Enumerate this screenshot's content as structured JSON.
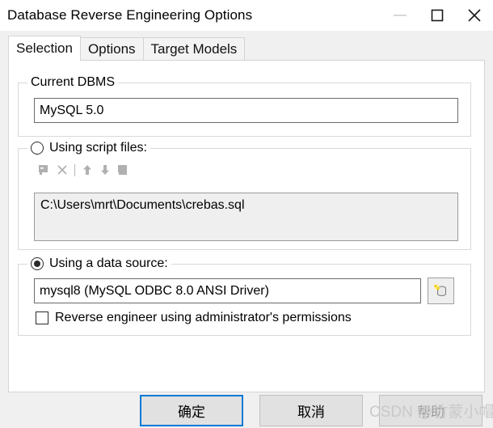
{
  "window": {
    "title": "Database Reverse Engineering Options",
    "controls": {
      "minimize": "minimize",
      "maximize": "maximize",
      "close": "close"
    }
  },
  "tabs": [
    {
      "label": "Selection",
      "active": true
    },
    {
      "label": "Options",
      "active": false
    },
    {
      "label": "Target Models",
      "active": false
    }
  ],
  "dbms_group": {
    "legend": "Current DBMS",
    "value": "MySQL 5.0"
  },
  "script_group": {
    "legend": "Using script files:",
    "selected": false,
    "toolbar": [
      "add-script-file-icon",
      "delete-script-file-icon",
      "separator",
      "move-up-icon",
      "move-down-icon",
      "edit-script-file-icon"
    ],
    "files": [
      "C:\\Users\\mrt\\Documents\\crebas.sql"
    ]
  },
  "datasource_group": {
    "legend": "Using a data source:",
    "selected": true,
    "value": "mysql8 (MySQL ODBC 8.0 ANSI Driver)",
    "browse_icon": "database-icon",
    "admin_checkbox": {
      "label": "Reverse engineer using administrator's permissions",
      "checked": false
    }
  },
  "footer": {
    "ok_label": "确定",
    "cancel_label": "取消",
    "help_label": "帮助",
    "help_enabled": false
  },
  "watermark": {
    "text": "CSDN @竹蒙小帽"
  },
  "colors": {
    "accent": "#0078d7",
    "window_bg": "#f0f0f0",
    "panel_bg": "#ffffff",
    "disabled_text": "#9a9a9a"
  }
}
